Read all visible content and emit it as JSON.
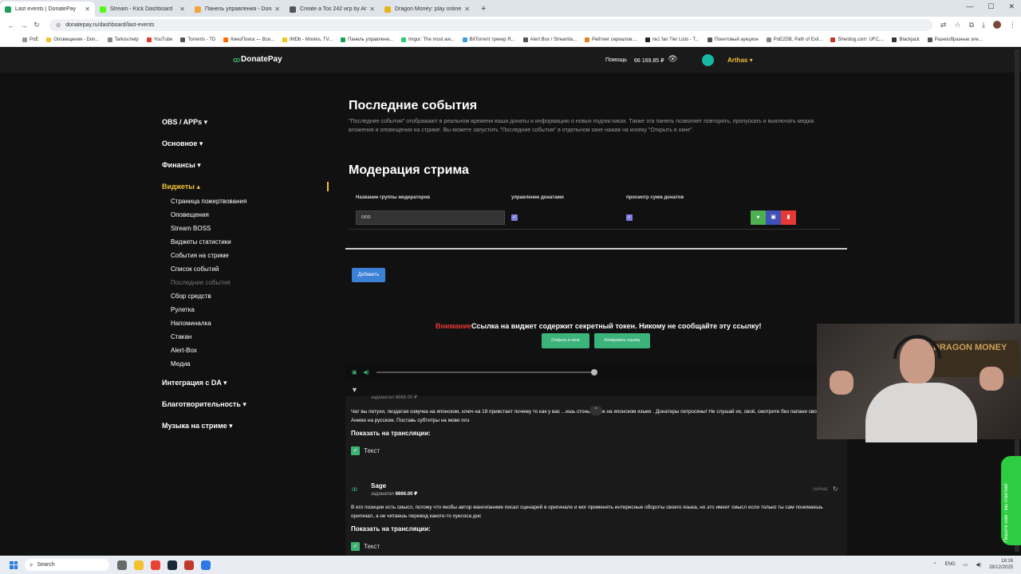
{
  "browser": {
    "tabs": [
      {
        "label": "Last events | DonatePay",
        "color": "#1d9e5b",
        "active": true
      },
      {
        "label": "Stream - Kick Dashboard",
        "color": "#53fc18",
        "active": false
      },
      {
        "label": "Панель управления - Donatio",
        "color": "#f3a33b",
        "active": false
      },
      {
        "label": "Create a Tos 242 игр by Arthas",
        "color": "#555555",
        "active": false
      },
      {
        "label": "Dragon Money: play online casi",
        "color": "#e8b21d",
        "active": false
      }
    ],
    "new_tab": "+",
    "url": "donatepay.ru/dashboard/last-events",
    "bookmarks": [
      "PoE",
      "Оповещения - Don...",
      "Tarkov.help",
      "YouTube",
      "Torrents - TD",
      "КиноПоиск — Все...",
      "IMDb - Movies, TV...",
      "Панель управлени...",
      "Imgur: The most aw...",
      "BitTorrent трекер R...",
      "Alert Box / Streamla...",
      "Рейтинг сериалов:...",
      "№1 fan Tier Lists - T...",
      "Поинтовый аукцион",
      "PoE2DB, Path of Exil...",
      "Sherdog.com: UFC,...",
      "Blackjack",
      "Разнообразные эле..."
    ]
  },
  "header": {
    "logo": "DonatePay",
    "help": "Помощь",
    "balance": "66 169.85 ₽",
    "user": "Arthas ▾"
  },
  "sidebar": {
    "sections": [
      {
        "label": "OBS / APPs ▾"
      },
      {
        "label": "Основное ▾"
      },
      {
        "label": "Финансы ▾"
      },
      {
        "label": "Виджеты ▴"
      }
    ],
    "widget_items": [
      "Страница пожертвования",
      "Оповещения",
      "Stream BOSS",
      "Виджеты статистики",
      "События на стриме",
      "Список событий",
      "Последние события",
      "Сбор средств",
      "Рулетка",
      "Напоминалка",
      "Стакан",
      "Alert-Box",
      "Медиа"
    ],
    "bottom_sections": [
      "Интеграция с DA ▾",
      "Благотворительность ▾",
      "Музыка на стриме ▾"
    ]
  },
  "main": {
    "title": "Последние события",
    "description": "\"Последние события\" отображают в реальном времени ваши донаты и информацию о новых подписчиках. Также эта панель позволяет повторять, пропускать и выключать медиа вложения и оповещения на стриме. Вы можете запустить \"Последние события\" в отдельном окне нажав на кнопку \"Открыть в окне\".",
    "moderation_title": "Модерация стрима",
    "columns": [
      "Название группы модераторов",
      "управление донатами",
      "просмотр сумм донатов"
    ],
    "group_value": "ооо",
    "add_button": "Добавить",
    "warning_red": "Внимание",
    "warning_text": "Ссылка на виджет содержит секретный токен. Никому не сообщайте эту ссылку!",
    "open_window": "Открыть в окне",
    "copy_link": "Копировать ссылку"
  },
  "feed": {
    "partial_sum": "задонатил 6666.00 ₽",
    "msg1": "Чат вы петухи, пиздатая озвучка на японском, ключ на 18 привстает почему то как у вас ...ишь стоны тянок на японском языке . Донатеры петросяны! Не слушай их, своё, смотрите без папани свое Анимэ на русском. Поставь субтитры на мове плз",
    "show_label": "Показать на трансляции:",
    "text_label": "Текст",
    "donor_name": "Sage",
    "donor_prefix": "задонатил",
    "donor_amount": "6666.00 ₽",
    "time": "сейчас",
    "msg2": "В его позиции есть смысл, потому что якобы автор манги/аниме писал сценарий в оригинале и мог применять интересные обороты своего языка, но это имеет смысл если только ты сам понимаешь оригинал, а не читаешь перевод какого-то хуесоса днс",
    "show_label2": "Показать на трансляции:",
    "text_label2": "Текст"
  },
  "webcam": {
    "sign": "DRAGON MONEY"
  },
  "side_widget": "Пишите нам - мы ответим!",
  "taskbar": {
    "search": "Search",
    "lang": "ENG",
    "time": "18:16",
    "date": "28/12/2025"
  }
}
